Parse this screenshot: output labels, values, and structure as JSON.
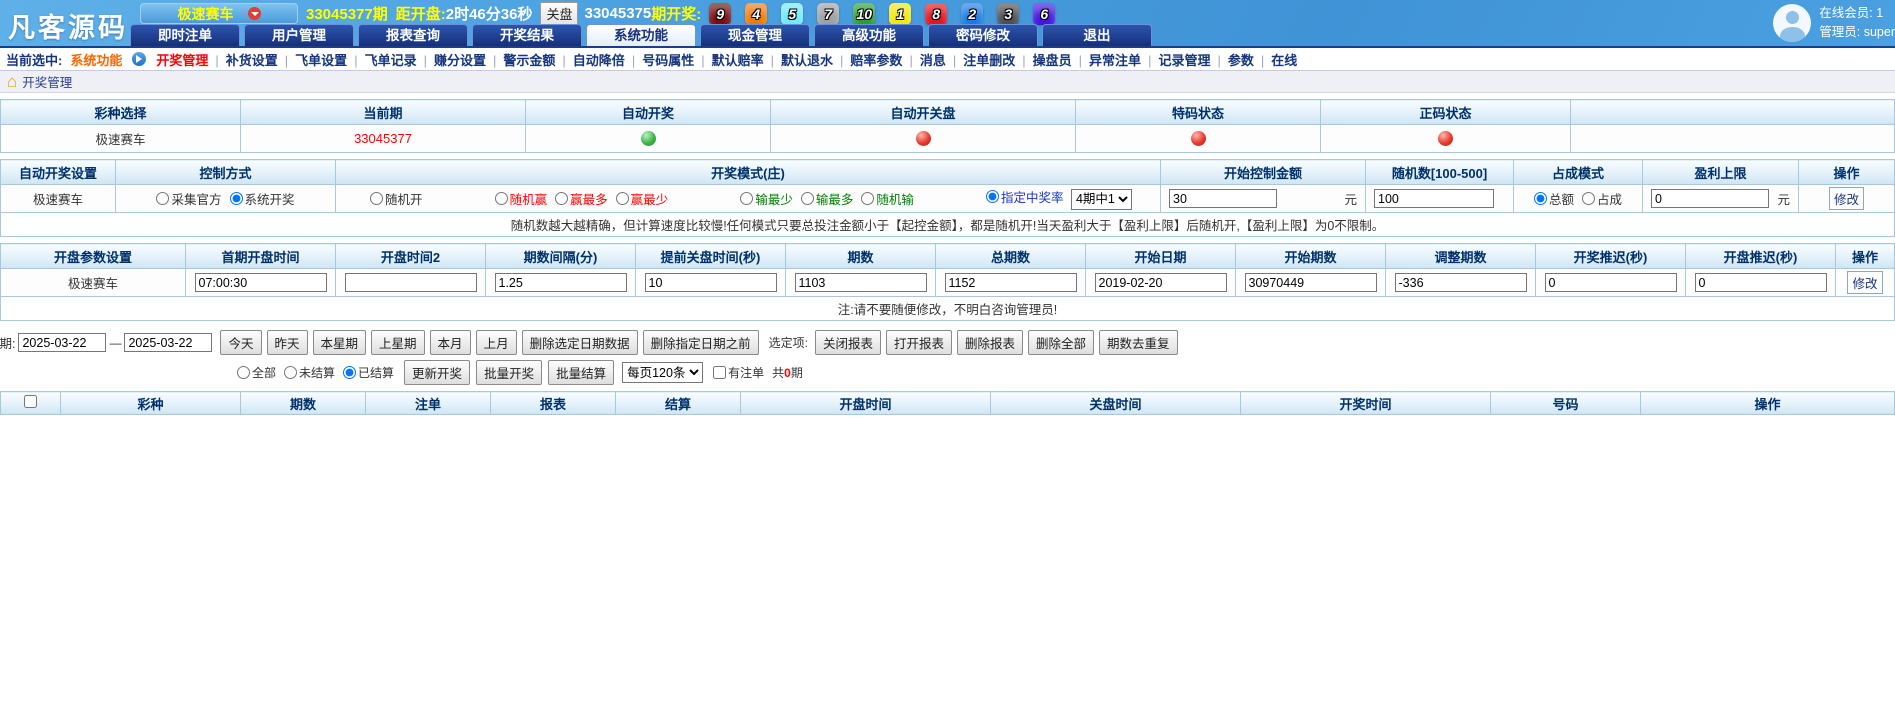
{
  "colors": {
    "header_blue": "#4aa0e0",
    "nav_navy": "#163079",
    "accent_yellow": "#ffff00",
    "accent_red": "#ff0000",
    "status_green": "#3cb54a",
    "status_red": "#e53b2e"
  },
  "header": {
    "logo": "凡客源码",
    "lottery_name": "极速赛车",
    "current_period": "33045377期",
    "countdown_label": "距开盘:",
    "countdown_value": "2时46分36秒",
    "close_button": "关盘",
    "result_period": "33045375",
    "result_label": "期开奖:",
    "balls": [
      {
        "num": "9",
        "color": "#7a0c10"
      },
      {
        "num": "4",
        "color": "#f07b0c"
      },
      {
        "num": "5",
        "color": "#70e8f8"
      },
      {
        "num": "7",
        "color": "#9fa0a2"
      },
      {
        "num": "10",
        "color": "#27a12d"
      },
      {
        "num": "1",
        "color": "#f0e713"
      },
      {
        "num": "8",
        "color": "#e6151c"
      },
      {
        "num": "2",
        "color": "#1b7ce4"
      },
      {
        "num": "3",
        "color": "#4d4f51"
      },
      {
        "num": "6",
        "color": "#4613e0"
      }
    ],
    "online_member": "在线会员: 1",
    "admin": "管理员: super"
  },
  "nav": {
    "tabs": [
      "即时注单",
      "用户管理",
      "报表查询",
      "开奖结果",
      "系统功能",
      "现金管理",
      "高级功能",
      "密码修改",
      "退出"
    ]
  },
  "subnav": {
    "prefix": "当前选中:",
    "module": "系统功能",
    "links": [
      "开奖管理",
      "补货设置",
      "飞单设置",
      "飞单记录",
      "赚分设置",
      "警示金额",
      "自动降倍",
      "号码属性",
      "默认赔率",
      "默认退水",
      "赔率参数",
      "消息",
      "注单删改",
      "操盘员",
      "异常注单",
      "记录管理",
      "参数",
      "在线"
    ]
  },
  "breadcrumb": {
    "title": "开奖管理"
  },
  "lottery_status": {
    "headers": [
      "彩种选择",
      "当前期",
      "自动开奖",
      "自动开关盘",
      "特码状态",
      "正码状态"
    ],
    "row": {
      "name": "极速赛车",
      "period": "33045377",
      "auto_draw": "green",
      "auto_gate": "red",
      "special_code": "red",
      "normal_code": "red"
    }
  },
  "auto_draw": {
    "headers": [
      "自动开奖设置",
      "控制方式",
      "开奖模式(庄)",
      "开始控制金额",
      "随机数[100-500]",
      "占成模式",
      "盈利上限",
      "操作"
    ],
    "row": {
      "name": "极速赛车",
      "control_options": [
        {
          "label": "采集官方",
          "checked": false
        },
        {
          "label": "系统开奖",
          "checked": true
        }
      ],
      "mode_plain": [
        {
          "label": "随机开",
          "checked": false
        }
      ],
      "mode_win": [
        {
          "label": "随机赢",
          "checked": false
        },
        {
          "label": "赢最多",
          "checked": false
        },
        {
          "label": "赢最少",
          "checked": false
        }
      ],
      "mode_lose": [
        {
          "label": "输最少",
          "checked": false
        },
        {
          "label": "输最多",
          "checked": false
        },
        {
          "label": "随机输",
          "checked": false
        }
      ],
      "mode_rate_label": "指定中奖率",
      "mode_rate_checked": true,
      "rate_select": "4期中1",
      "start_amount": "30",
      "start_amount_unit": "元",
      "random_num": "100",
      "share_options": [
        {
          "label": "总额",
          "checked": true
        },
        {
          "label": "占成",
          "checked": false
        }
      ],
      "profit_limit": "0",
      "profit_limit_unit": "元",
      "action": "修改"
    },
    "note": "随机数越大越精确，但计算速度比较慢!任何模式只要总投注金额小于【起控金额】，都是随机开!当天盈利大于【盈利上限】后随机开,【盈利上限】为0不限制。"
  },
  "open_params": {
    "headers": [
      "开盘参数设置",
      "首期开盘时间",
      "开盘时间2",
      "期数间隔(分)",
      "提前关盘时间(秒)",
      "期数",
      "总期数",
      "开始日期",
      "开始期数",
      "调整期数",
      "开奖推迟(秒)",
      "开盘推迟(秒)",
      "操作"
    ],
    "row_name": "极速赛车",
    "values": [
      "07:00:30",
      "",
      "1.25",
      "10",
      "1103",
      "1152",
      "2019-02-20",
      "30970449",
      "-336",
      "0",
      "0"
    ],
    "action": "修改",
    "note": "注:请不要随便修改，不明白咨询管理员!"
  },
  "filters": {
    "date_label": "日期:",
    "date_from": "2025-03-22",
    "date_sep": "—",
    "date_to": "2025-03-22",
    "date_buttons": [
      "今天",
      "昨天",
      "本星期",
      "上星期",
      "本月",
      "上月",
      "删除选定日期数据",
      "删除指定日期之前"
    ],
    "selected_label": "选定项:",
    "report_buttons": [
      "关闭报表",
      "打开报表",
      "删除报表",
      "删除全部",
      "期数去重复"
    ],
    "status_options": [
      {
        "label": "全部",
        "checked": false
      },
      {
        "label": "未结算",
        "checked": false
      },
      {
        "label": "已结算",
        "checked": true
      }
    ],
    "action_buttons": [
      "更新开奖",
      "批量开奖",
      "批量结算"
    ],
    "page_size": "每页120条",
    "has_bets_label": "有注单",
    "total_prefix": "共",
    "total_count": "0",
    "total_suffix": "期"
  },
  "list_table": {
    "headers": [
      "彩种",
      "期数",
      "注单",
      "报表",
      "结算",
      "开盘时间",
      "关盘时间",
      "开奖时间",
      "号码",
      "操作"
    ]
  }
}
